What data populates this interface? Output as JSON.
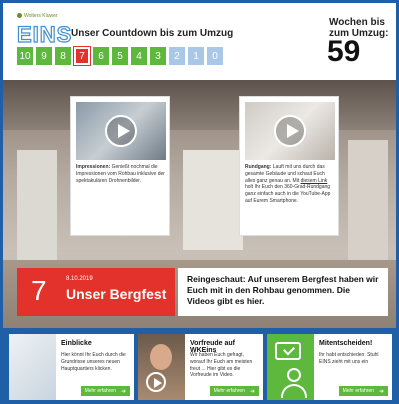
{
  "header": {
    "logo_small": "Wolters Kluwer",
    "logo_main": "EINS",
    "countdown_title": "Unser Countdown bis zum Umzug",
    "weeks_label": "Wochen bis zum Umzug:",
    "weeks_value": "59",
    "countdown_boxes": [
      {
        "value": "10",
        "state": "done"
      },
      {
        "value": "9",
        "state": "done"
      },
      {
        "value": "8",
        "state": "done"
      },
      {
        "value": "7",
        "state": "current"
      },
      {
        "value": "6",
        "state": "done"
      },
      {
        "value": "5",
        "state": "done"
      },
      {
        "value": "4",
        "state": "done"
      },
      {
        "value": "3",
        "state": "done"
      },
      {
        "value": "2",
        "state": "upcoming"
      },
      {
        "value": "1",
        "state": "upcoming"
      },
      {
        "value": "0",
        "state": "upcoming"
      }
    ]
  },
  "hero": {
    "card_impressionen": {
      "title": "Impressionen:",
      "text": "Genießt nochmal die Impressionen vom Rohbau inklusive der spektakulären Drohnenbilder."
    },
    "card_rundgang": {
      "title": "Rundgang:",
      "text_before": "Lauft mit uns durch das gesamte Gebäude und schaut Euch alles ganz genau an. Mit",
      "link": "diesem Link",
      "text_after": "holt Ihr Euch den 360-Grad-Rundgang ganz einfach auch in die YouTube-App auf Eurem Smartphone."
    },
    "episode_number": "7",
    "episode_date": "8.10.2019",
    "episode_title": "Unser Bergfest",
    "episode_description": "Reingeschaut: Auf unserem Bergfest haben wir Euch mit in den Rohbau genommen. Die Videos gibt es hier."
  },
  "teasers": [
    {
      "title": "Einblicke",
      "text": "Hier könnt Ihr Euch durch die Grundrisse unseres neuen Hauptquartiers klicken.",
      "more": "Mehr erfahren"
    },
    {
      "title": "Vorfreude auf WKEins",
      "text": "Wir haben Euch gefragt, worauf Ihr Euch am meisten freut ... Hier gibt es die Vorfreude im Video.",
      "more": "Mehr erfahren"
    },
    {
      "title": "Mitentscheiden!",
      "text": "Ihr habt entschieden: Stuhl EINS zieht mit uns ein",
      "more": "Mehr erfahren"
    }
  ],
  "colors": {
    "accent_red": "#e3312b",
    "accent_green": "#5eb83d",
    "upcoming_blue": "#a9c8e8",
    "frame_blue": "#1f5fa8"
  }
}
